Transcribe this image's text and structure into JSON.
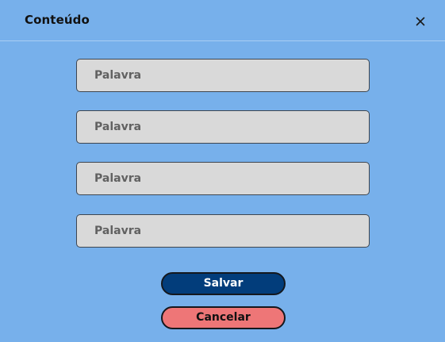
{
  "dialog": {
    "title": "Conteúdo",
    "close_icon": "close-icon"
  },
  "fields": [
    {
      "placeholder": "Palavra",
      "value": ""
    },
    {
      "placeholder": "Palavra",
      "value": ""
    },
    {
      "placeholder": "Palavra",
      "value": ""
    },
    {
      "placeholder": "Palavra",
      "value": ""
    }
  ],
  "actions": {
    "save_label": "Salvar",
    "cancel_label": "Cancelar"
  },
  "colors": {
    "background": "#77b0eb",
    "field_background": "#d9d9d9",
    "save_button": "#023d7b",
    "cancel_button": "#ee7677"
  }
}
